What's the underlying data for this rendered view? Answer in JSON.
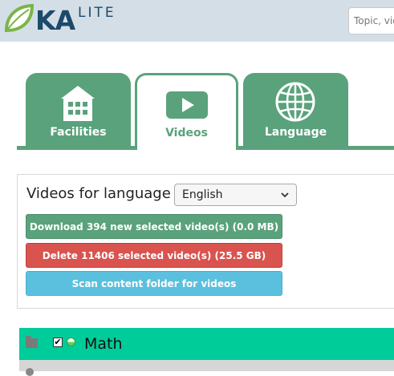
{
  "header": {
    "logo_ka": "KA",
    "logo_lite": "LITE",
    "search_placeholder": "Topic, video, exercise"
  },
  "tabs": [
    {
      "label": "Facilities",
      "icon": "building-icon",
      "active": false
    },
    {
      "label": "Videos",
      "icon": "play-video-icon",
      "active": true
    },
    {
      "label": "Language",
      "icon": "globe-icon",
      "active": false
    }
  ],
  "panel": {
    "title": "Videos for language",
    "language_selected": "English",
    "download_label": "Download 394 new selected video(s) (0.0 MB)",
    "delete_label": "Delete 11406 selected video(s) (25.5 GB)",
    "scan_label": "Scan content folder for videos"
  },
  "tree": {
    "items": [
      {
        "title": "Math",
        "checked": true,
        "icon": "folder-icon"
      }
    ],
    "check_mark": "✔"
  },
  "colors": {
    "accent": "#5aa27c",
    "header_bg": "#d4dee7",
    "danger": "#d9534f",
    "info": "#5bc0de",
    "tree_highlight": "#00cc99"
  }
}
